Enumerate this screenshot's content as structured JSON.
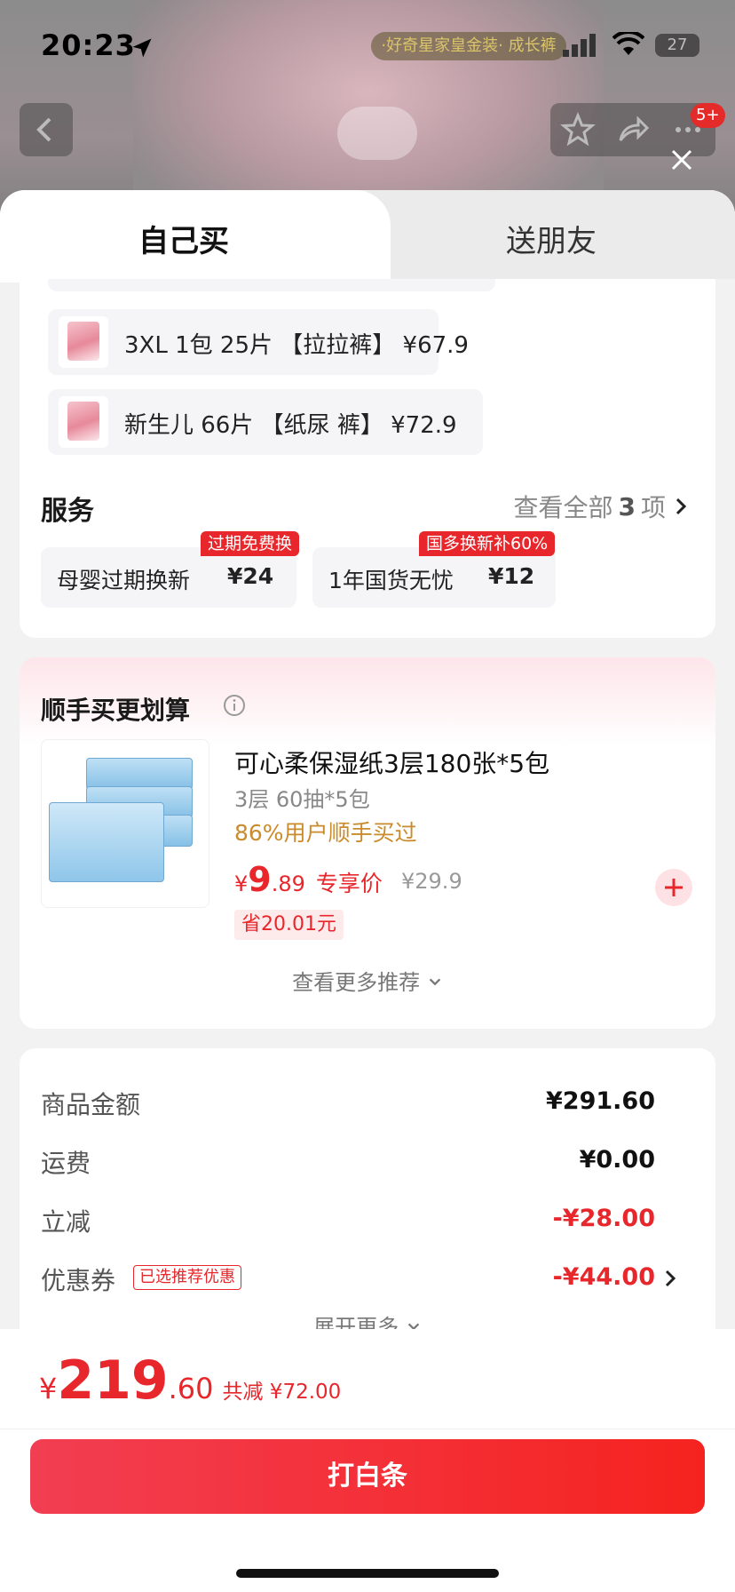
{
  "status_bar": {
    "time": "20:23",
    "battery": "27"
  },
  "background_page": {
    "banner": "·好奇星家皇金装·  成长裤"
  },
  "nav": {
    "badge": "5+"
  },
  "tabs": [
    {
      "label": "自己买"
    },
    {
      "label": "送朋友"
    }
  ],
  "sku_options": [
    {
      "label": "3XL 1包 25片 【拉拉裤】  ¥67.9"
    },
    {
      "label": "新生儿 66片 【纸尿 裤】  ¥72.9"
    }
  ],
  "services": {
    "title": "服务",
    "view_all_prefix": "查看全部",
    "view_all_count": "3",
    "view_all_suffix": "项",
    "items": [
      {
        "name": "母婴过期换新",
        "price": "¥24",
        "tag": "过期免费换"
      },
      {
        "name": "1年国货无忧",
        "price": "¥12",
        "tag": "国多换新补60%"
      }
    ]
  },
  "recommend": {
    "title": "顺手买更划算",
    "product_name": "可心柔保湿纸3层180张*5包",
    "spec": "3层 60抽*5包",
    "buy_rate": "86%用户顺手买过",
    "price_currency": "¥",
    "price_int": "9",
    "price_dec": ".89",
    "price_tag": "专享价",
    "original_price": "¥29.9",
    "save": "省20.01元",
    "more": "查看更多推荐"
  },
  "summary": {
    "rows": [
      {
        "label": "商品金额",
        "value": "¥291.60"
      },
      {
        "label": "运费",
        "value": "¥0.00"
      },
      {
        "label": "立减",
        "value": "-¥28.00"
      },
      {
        "label": "优惠券",
        "value": "-¥44.00",
        "tag": "已选推荐优惠"
      }
    ],
    "expand": "展开更多"
  },
  "bottom": {
    "currency": "¥",
    "total_int": "219",
    "total_dec": ".60",
    "saved": "共减 ¥72.00",
    "pay_label": "打白条"
  },
  "colors": {
    "accent": "#e8272c",
    "pay_button": "#f23e52"
  }
}
